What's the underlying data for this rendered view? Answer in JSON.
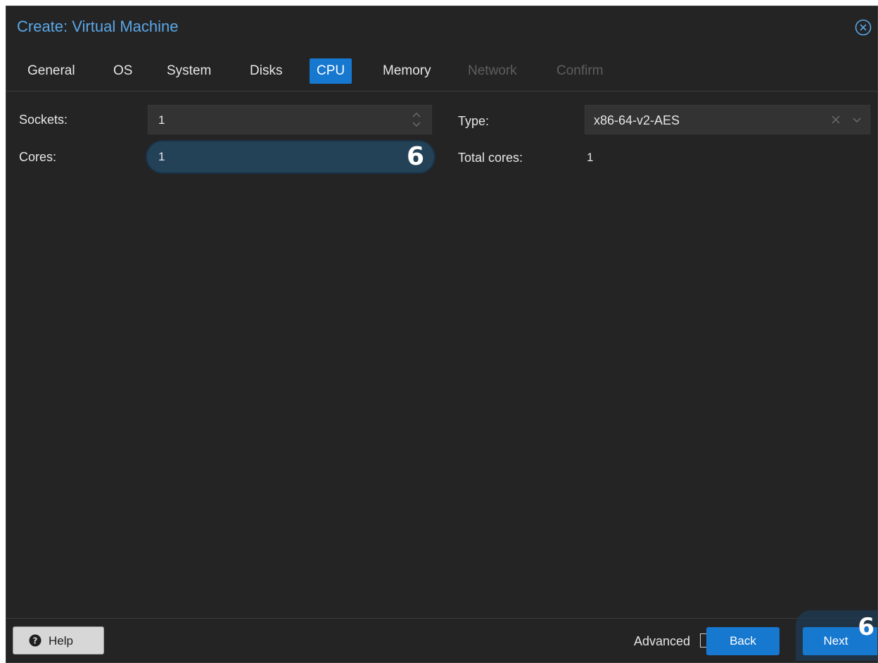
{
  "window": {
    "title": "Create: Virtual Machine",
    "close_icon": "close-circle-icon"
  },
  "tabs": [
    {
      "label": "General",
      "state": "normal"
    },
    {
      "label": "OS",
      "state": "normal"
    },
    {
      "label": "System",
      "state": "normal"
    },
    {
      "label": "Disks",
      "state": "normal"
    },
    {
      "label": "CPU",
      "state": "active"
    },
    {
      "label": "Memory",
      "state": "normal"
    },
    {
      "label": "Network",
      "state": "disabled"
    },
    {
      "label": "Confirm",
      "state": "disabled"
    }
  ],
  "form": {
    "sockets": {
      "label": "Sockets:",
      "value": "1"
    },
    "cores": {
      "label": "Cores:",
      "value": "1",
      "annotation": "6"
    },
    "type": {
      "label": "Type:",
      "value": "x86-64-v2-AES"
    },
    "total_cores": {
      "label": "Total cores:",
      "value": "1"
    }
  },
  "footer": {
    "help_label": "Help",
    "advanced_label": "Advanced",
    "advanced_checked": false,
    "back_label": "Back",
    "next_label": "Next",
    "next_annotation": "6"
  },
  "colors": {
    "accent": "#1778d0",
    "title": "#5aa7e8",
    "background": "#242424",
    "field": "#333333",
    "focused_field": "#234258"
  }
}
